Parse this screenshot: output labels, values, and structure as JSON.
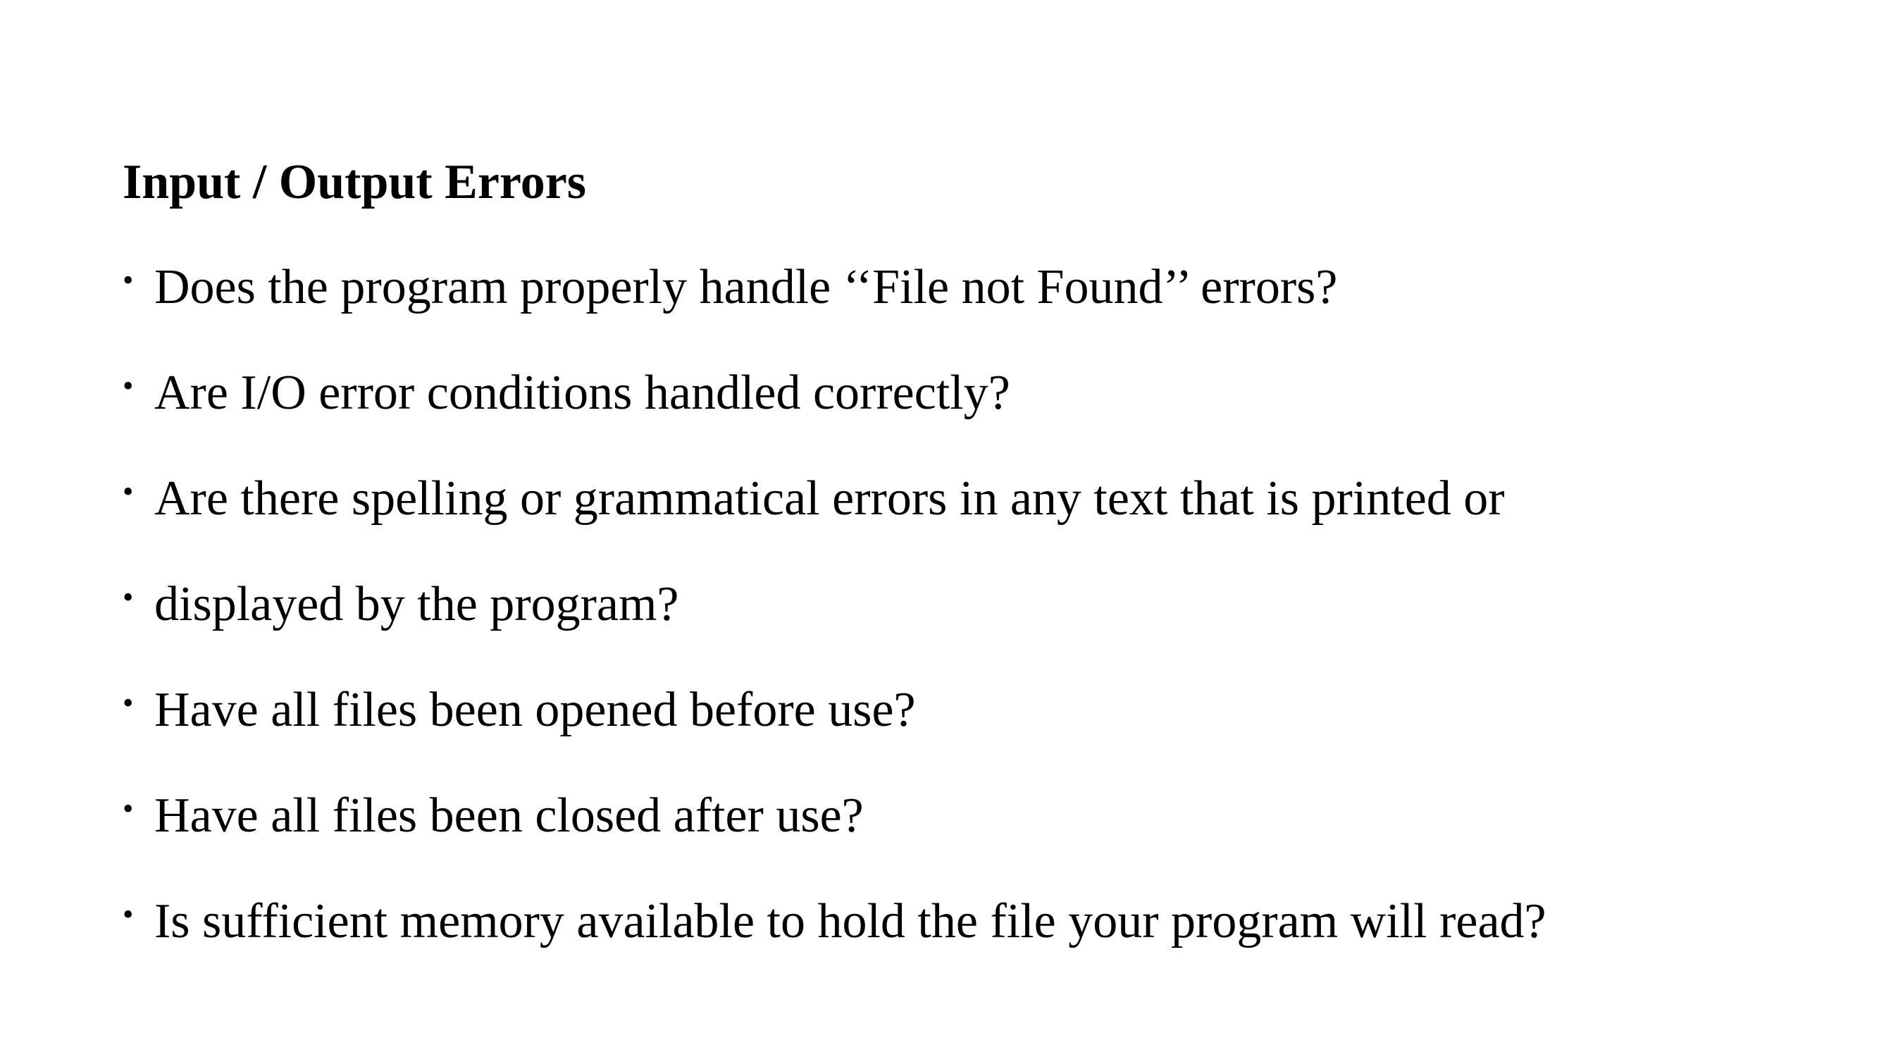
{
  "slide": {
    "heading": "Input / Output Errors",
    "bullet_glyph": "•",
    "bullets": [
      "Does the program properly handle ‘‘File not Found’’ errors?",
      "Are I/O error conditions handled correctly?",
      "Are there spelling or grammatical errors in any text that is printed or",
      "displayed by the program?",
      "Have all files been opened before use?",
      "Have all files been closed after use?",
      "Is sufficient memory available to hold the file your program will read?"
    ]
  }
}
